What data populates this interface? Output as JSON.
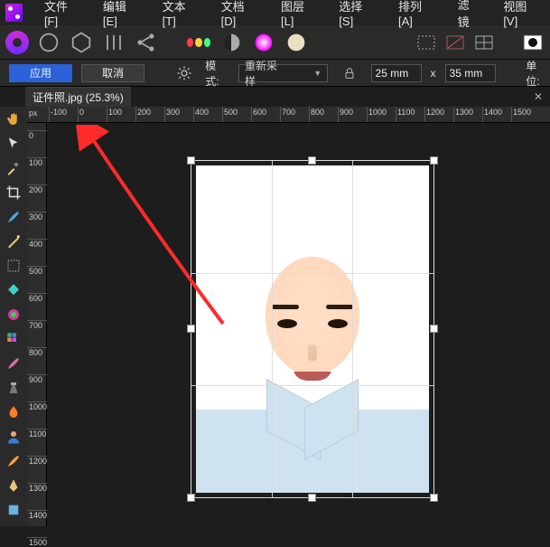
{
  "menu": {
    "items": [
      "文件[F]",
      "编辑[E]",
      "文本[T]",
      "文档[D]",
      "图层[L]",
      "选择[S]",
      "排列[A]",
      "滤镜",
      "视图[V]"
    ]
  },
  "toolbar2": {
    "apply": "应用",
    "cancel": "取消",
    "mode_label": "模式:",
    "mode_value": "重新采样",
    "width": "25 mm",
    "x": "x",
    "height": "35 mm",
    "unit_label": "单位:"
  },
  "doc": {
    "tab_name": "证件照.jpg (25.3%)"
  },
  "ruler": {
    "unit": "px",
    "h_ticks": [
      -100,
      0,
      100,
      200,
      300,
      400,
      500,
      600,
      700,
      800,
      900,
      1000,
      1100,
      1200,
      1300,
      1400,
      1500
    ],
    "v_ticks": [
      0,
      100,
      200,
      300,
      400,
      500,
      600,
      700,
      800,
      900,
      1000,
      1100,
      1200,
      1300,
      1400,
      1500
    ]
  }
}
